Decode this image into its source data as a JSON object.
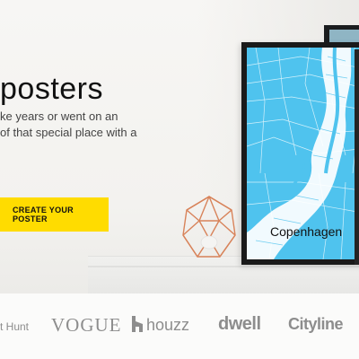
{
  "hero": {
    "title": "posters",
    "subtitle": "ke years or went on an\nof that special place with a",
    "cta_label": "CREATE YOUR POSTER"
  },
  "poster": {
    "city_label": "Copenhagen",
    "map_water_color": "#4fc3ee",
    "map_land_color": "#ffffff",
    "frame_color": "#1a1a1a"
  },
  "logos": {
    "items": [
      "t Hunt",
      "VOGUE",
      "houzz",
      "dwell",
      "Cityline"
    ]
  },
  "colors": {
    "accent": "#ffdc00",
    "logo_gray": "#8d8d8d"
  }
}
